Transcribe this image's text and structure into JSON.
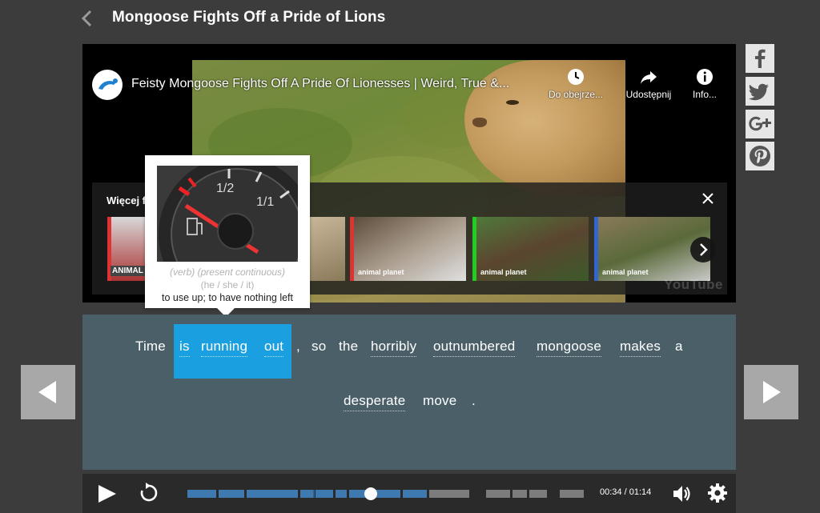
{
  "header": {
    "title": "Mongoose Fights Off a Pride of Lions"
  },
  "video": {
    "title": "Feisty Mongoose Fights Off A Pride Of Lionesses | Weird, True &...",
    "actions": [
      {
        "icon": "clock-icon",
        "label": "Do obejrze..."
      },
      {
        "icon": "share-icon",
        "label": "Udostępnij"
      },
      {
        "icon": "info-icon",
        "label": "Info..."
      }
    ],
    "more_videos_title": "Więcej f",
    "thumb_brand": "animal planet",
    "thumb_brand_logo": "ANIMAL PLANET",
    "watermark": "YouTube"
  },
  "share": [
    "facebook",
    "twitter",
    "google-plus",
    "pinterest"
  ],
  "definition": {
    "gauge_labels": [
      "1/2",
      "1/1"
    ],
    "part_of_speech": "(verb)",
    "tense": "(present continuous)",
    "persons": "(he / she / it)",
    "meaning": "to use up; to have nothing left"
  },
  "sentence": {
    "line1": [
      "Time",
      "is",
      "running",
      "out",
      ",",
      "so",
      "the",
      "horribly",
      "outnumbered",
      "mongoose",
      "makes",
      "a"
    ],
    "line2": [
      "desperate",
      "move",
      "."
    ]
  },
  "player": {
    "current_time": "00:34",
    "separator": "/",
    "duration": "01:14",
    "progress": 0.46
  },
  "colors": {
    "background": "#3c3c3c",
    "sentence_panel": "#4b5f69",
    "highlight": "#1aa0e0",
    "progress_played": "#3e79b0"
  }
}
